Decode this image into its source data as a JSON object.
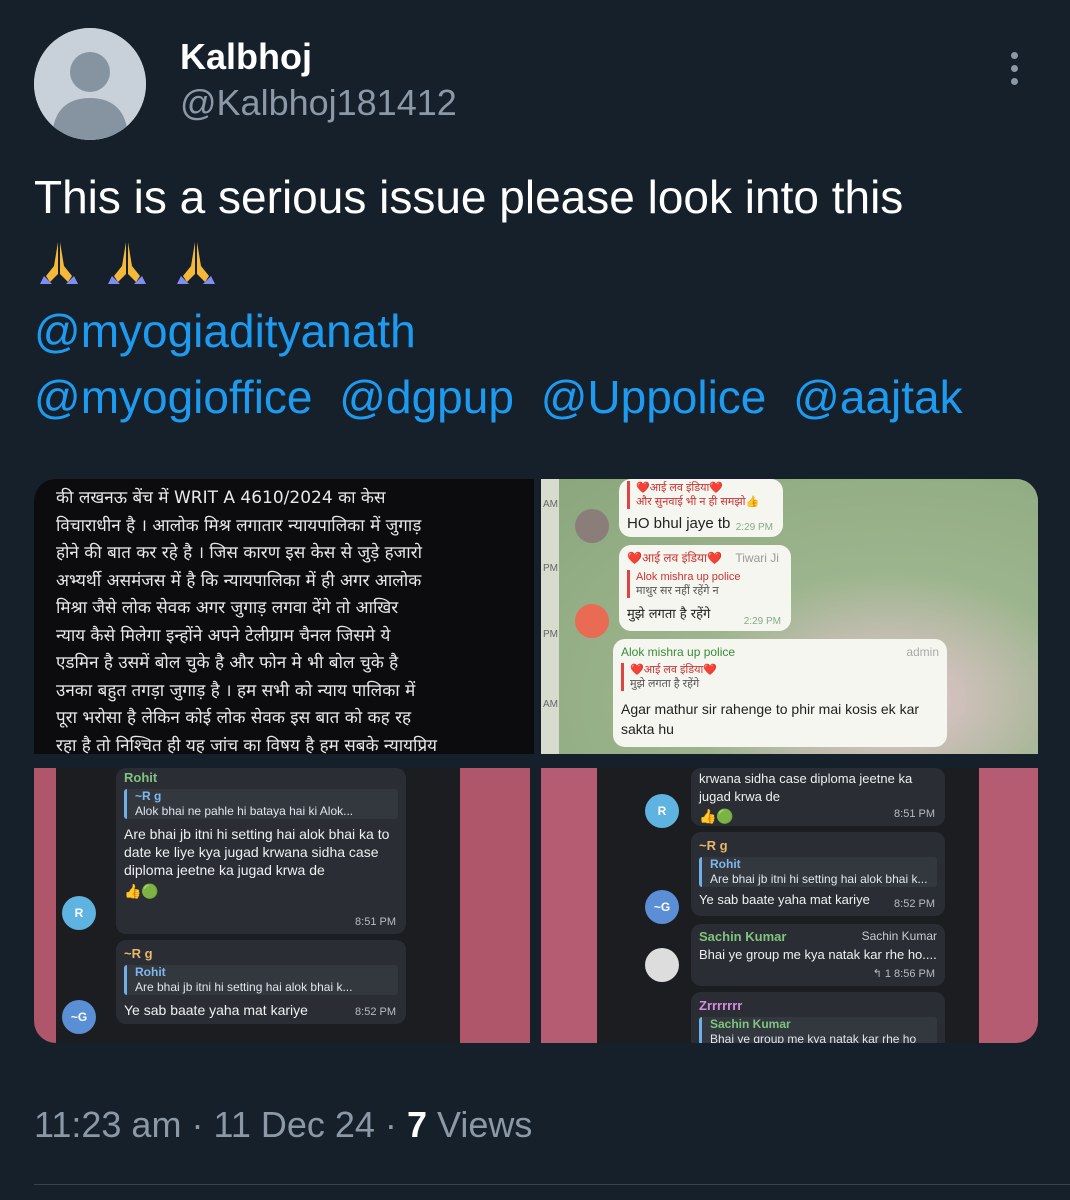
{
  "user": {
    "display_name": "Kalbhoj",
    "handle": "@Kalbhoj181412"
  },
  "tweet": {
    "text": "This is a serious issue please look into this",
    "emojis": [
      "pray",
      "pray",
      "pray"
    ],
    "mentions_line1": [
      "@myogiadityanath"
    ],
    "mentions_line2": [
      "@myogioffice",
      "@dgpup",
      "@Uppolice",
      "@aajtak"
    ]
  },
  "media": {
    "panel1_lines": [
      "की लखनऊ बेंच में WRIT A 4610/2024  का केस",
      "विचाराधीन है । आलोक मिश्र लगातार न्यायपालिका में जुगाड़",
      "होने की बात कर रहे है । जिस कारण इस केस से जुड़े हजारो",
      "अभ्यर्थी असमंजस में है कि न्यायपालिका में ही अगर आलोक",
      "मिश्रा जैसे लोक सेवक अगर जुगाड़ लगवा देंगे तो आखिर",
      "न्याय कैसे मिलेगा इन्होंने अपने टेलीग्राम चैनल जिसमे ये",
      "एडमिन है उसमें बोल चुके है और फोन मे भी बोल चुके है",
      "उनका बहुत तगड़ा जुगाड़ है । हम सभी को न्याय पालिका में",
      "पूरा भरोसा है लेकिन कोई लोक सेवक इस बात को कह रह",
      "रहा है तो निश्चित ही यह जांच का विषय है हम सबके न्यायप्रिय"
    ],
    "panel2": {
      "side_letters": [
        "AM",
        "PM",
        "PM",
        "AM"
      ],
      "msg1_quote": [
        "❤️आई लव इंडिया❤️",
        "और सुनवाई भी न ही समझो👍"
      ],
      "msg1_text": "HO bhul jaye tb",
      "msg1_time": "2:29 PM",
      "msg2_header": "❤️आई लव इंडिया❤️",
      "msg2_sender_tag": "Tiwari Ji",
      "msg2_quote_name": "Alok mishra up police",
      "msg2_quote_text": "माथुर सर नहीं रहेंगे न",
      "msg2_text": "मुझे लगता है रहेंगे",
      "msg2_time": "2:29 PM",
      "msg3_sender": "Alok mishra up police",
      "msg3_role": "admin",
      "msg3_quote_name": "❤️आई लव इंडिया❤️",
      "msg3_quote_text": "मुझे लगता है रहेंगे",
      "msg3_text": "Agar mathur sir rahenge to phir mai kosis ek kar sakta hu"
    },
    "panel3": {
      "msg1_sender": "Rohit",
      "msg1_quote_name": "~R g",
      "msg1_quote_text": "Alok  bhai ne pahle hi bataya hai ki Alok...",
      "msg1_text": "Are bhai jb itni hi setting hai alok bhai ka  to date ke liye kya jugad krwana sidha case diploma jeetne ka jugad krwa de",
      "msg1_reacts": "👍🟢",
      "msg1_time": "8:51 PM",
      "msg1_avatar": "R",
      "msg2_sender": "~R g",
      "msg2_quote_name": "Rohit",
      "msg2_quote_text": "Are bhai jb itni hi setting hai alok bhai k...",
      "msg2_text": "Ye sab baate yaha mat kariye",
      "msg2_time": "8:52 PM",
      "msg2_avatar": "~G"
    },
    "panel4": {
      "msg1_text": "krwana sidha case diploma jeetne ka jugad krwa de",
      "msg1_reacts": "👍🟢",
      "msg1_time": "8:51 PM",
      "msg1_avatar": "R",
      "msg2_sender": "~R g",
      "msg2_quote_name": "Rohit",
      "msg2_quote_text": "Are bhai jb itni hi setting hai alok bhai k...",
      "msg2_text": "Ye sab baate yaha mat kariye",
      "msg2_time": "8:52 PM",
      "msg2_avatar": "~G",
      "msg3_sender": "Sachin Kumar",
      "msg3_tag": "Sachin Kumar",
      "msg3_text": "Bhai ye group me kya natak kar rhe ho....",
      "msg3_meta": "↰ 1  8:56 PM",
      "msg4_sender": "Zrrrrrrr",
      "msg4_quote_name": "Sachin Kumar",
      "msg4_quote_text": "Bhai ye group me kya natak kar rhe ho"
    }
  },
  "footer": {
    "time": "11:23 am",
    "sep1": "·",
    "date": "11 Dec 24",
    "sep2": "·",
    "views_count": "7",
    "views_label": "Views"
  },
  "colors": {
    "background": "#15202b",
    "link": "#1d9bf0",
    "secondary_text": "#8b98a5"
  }
}
